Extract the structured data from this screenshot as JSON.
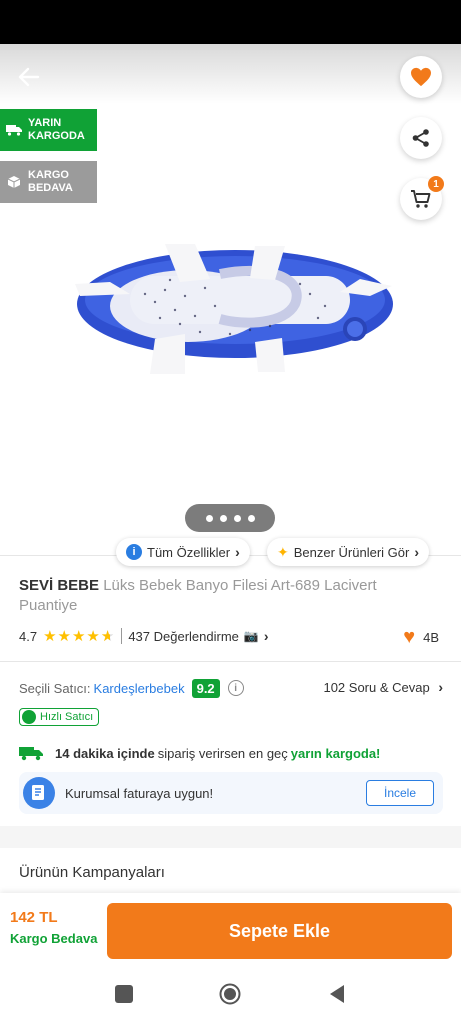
{
  "header": {
    "back_icon": "arrow-left-icon",
    "favorite_icon": "heart-icon",
    "share_icon": "share-icon",
    "cart_icon": "cart-icon",
    "cart_count": "1"
  },
  "badges": {
    "tomorrow_cargo": [
      "YARIN",
      "KARGODA"
    ],
    "free_cargo": [
      "KARGO",
      "BEDAVA"
    ]
  },
  "gallery": {
    "dot_count": 4,
    "active_dot": 1
  },
  "pills": {
    "all_features": "Tüm Özellikler",
    "similar_products": "Benzer Ürünleri Gör"
  },
  "product": {
    "brand": "SEVİ BEBE",
    "name": "Lüks Bebek Banyo Filesi Art-689 Lacivert Puantiye",
    "rating": "4.7",
    "rating_value": 4.7,
    "reviews": "437 Değerlendirme",
    "favorites": "4B"
  },
  "seller": {
    "label": "Seçili Satıcı:",
    "name": "Kardeşlerbebek",
    "score": "9.2",
    "qa": "102 Soru & Cevap",
    "fast_badge": "Hızlı Satıcı"
  },
  "delivery": {
    "time": "14 dakika içinde",
    "middle": "sipariş verirsen en geç",
    "highlight": "yarın kargoda!"
  },
  "invoice": {
    "text": "Kurumsal faturaya uygun!",
    "button": "İncele"
  },
  "campaigns": {
    "title": "Ürünün Kampanyaları"
  },
  "bottom": {
    "price": "142 TL",
    "shipping": "Kargo Bedava",
    "add_to_cart": "Sepete Ekle"
  },
  "colors": {
    "brand_orange": "#f27a1a",
    "green": "#10a236",
    "blue": "#2a7de1"
  }
}
